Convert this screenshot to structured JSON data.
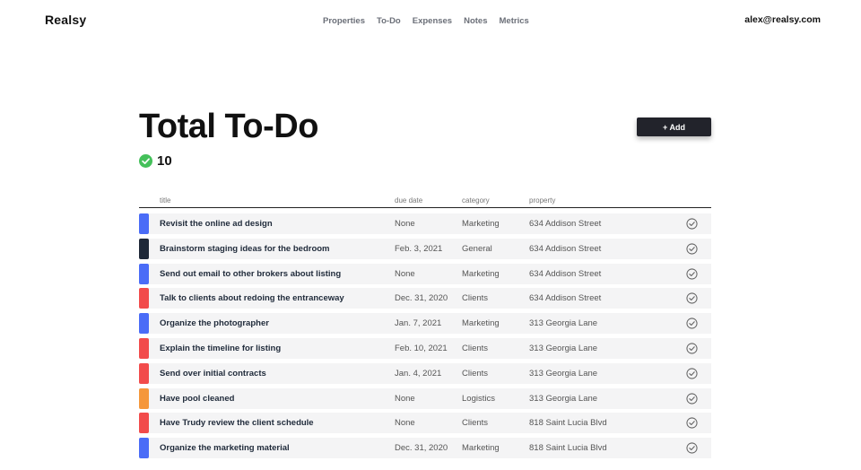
{
  "brand": "Realsy",
  "nav": {
    "links": [
      "Properties",
      "To-Do",
      "Expenses",
      "Notes",
      "Metrics"
    ],
    "user_email": "alex@realsy.com"
  },
  "page": {
    "title": "Total To-Do",
    "count": "10",
    "add_label": "+ Add"
  },
  "colors": {
    "marketing": "#4a6cf7",
    "general": "#1f2838",
    "clients": "#f24b4b",
    "logistics": "#f5973b",
    "check_green": "#44c05a",
    "button_dark": "#22232b"
  },
  "table": {
    "headers": {
      "title": "title",
      "due": "due date",
      "category": "category",
      "property": "property"
    },
    "rows": [
      {
        "title": "Revisit the online ad design",
        "due": "None",
        "category": "Marketing",
        "property": "634 Addison Street",
        "color": "#4a6cf7"
      },
      {
        "title": "Brainstorm staging ideas for the bedroom",
        "due": "Feb. 3, 2021",
        "category": "General",
        "property": "634 Addison Street",
        "color": "#1f2838"
      },
      {
        "title": "Send out email to other brokers about listing",
        "due": "None",
        "category": "Marketing",
        "property": "634 Addison Street",
        "color": "#4a6cf7"
      },
      {
        "title": "Talk to clients about redoing the entranceway",
        "due": "Dec. 31, 2020",
        "category": "Clients",
        "property": "634 Addison Street",
        "color": "#f24b4b"
      },
      {
        "title": "Organize the photographer",
        "due": "Jan. 7, 2021",
        "category": "Marketing",
        "property": "313 Georgia Lane",
        "color": "#4a6cf7"
      },
      {
        "title": "Explain the timeline for listing",
        "due": "Feb. 10, 2021",
        "category": "Clients",
        "property": "313 Georgia Lane",
        "color": "#f24b4b"
      },
      {
        "title": "Send over initial contracts",
        "due": "Jan. 4, 2021",
        "category": "Clients",
        "property": "313 Georgia Lane",
        "color": "#f24b4b"
      },
      {
        "title": "Have pool cleaned",
        "due": "None",
        "category": "Logistics",
        "property": "313 Georgia Lane",
        "color": "#f5973b"
      },
      {
        "title": "Have Trudy review the client schedule",
        "due": "None",
        "category": "Clients",
        "property": "818 Saint Lucia Blvd",
        "color": "#f24b4b"
      },
      {
        "title": "Organize the marketing material",
        "due": "Dec. 31, 2020",
        "category": "Marketing",
        "property": "818 Saint Lucia Blvd",
        "color": "#4a6cf7"
      }
    ]
  }
}
